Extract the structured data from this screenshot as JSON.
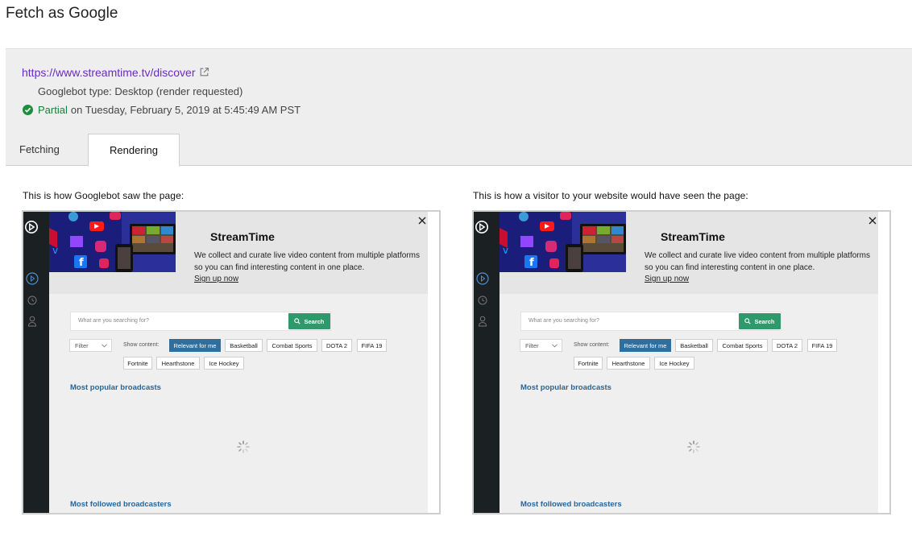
{
  "page_title": "Fetch as Google",
  "fetch": {
    "url": "https://www.streamtime.tv/discover",
    "googlebot_type": "Googlebot type: Desktop (render requested)",
    "status_label": "Partial",
    "status_detail": "on Tuesday, February 5, 2019 at 5:45:49 AM PST",
    "status_color": "#188038"
  },
  "tabs": [
    {
      "label": "Fetching",
      "active": false
    },
    {
      "label": "Rendering",
      "active": true
    }
  ],
  "captions": {
    "googlebot": "This is how Googlebot saw the page:",
    "visitor": "This is how a visitor to your website would have seen the page:"
  },
  "site": {
    "title": "StreamTime",
    "description": "We collect and curate live video content from multiple platforms so you can find interesting content in one place.",
    "signup": "Sign up now",
    "search_placeholder": "What are you searching for?",
    "search_button": "Search",
    "filter_label": "Filter",
    "show_content_label": "Show content:",
    "chips": [
      "Relevant for me",
      "Basketball",
      "Combat Sports",
      "DOTA 2",
      "FIFA 19",
      "Fortnite",
      "Hearthstone",
      "Ice Hockey"
    ],
    "section_popular": "Most popular broadcasts",
    "section_followed": "Most followed broadcasters",
    "accent_color": "#2e9a6c",
    "chip_active_color": "#2f6f9f",
    "sidebar_color": "#1b2023"
  }
}
